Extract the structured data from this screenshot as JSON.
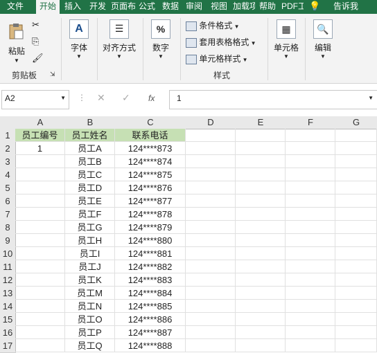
{
  "tabs": [
    "文件",
    "开始",
    "插入",
    "开发",
    "页面布",
    "公式",
    "数据",
    "审阅",
    "视图",
    "加载项",
    "帮助",
    "PDF工",
    "告诉我"
  ],
  "active_tab": "开始",
  "ribbon": {
    "paste": "粘贴",
    "clipboard_label": "剪贴板",
    "font": "字体",
    "align": "对齐方式",
    "number": "数字",
    "cond_format": "条件格式",
    "table_format": "套用表格格式",
    "cell_style": "单元格样式",
    "styles_label": "样式",
    "cells": "单元格",
    "edit": "编辑"
  },
  "formula_bar": {
    "name_box": "A2",
    "fx": "fx",
    "value": "1"
  },
  "columns": [
    "A",
    "B",
    "C",
    "D",
    "E",
    "F",
    "G"
  ],
  "header_row": [
    "员工编号",
    "员工姓名",
    "联系电话"
  ],
  "rows": [
    [
      "1",
      "员工A",
      "124****873"
    ],
    [
      "",
      "员工B",
      "124****874"
    ],
    [
      "",
      "员工C",
      "124****875"
    ],
    [
      "",
      "员工D",
      "124****876"
    ],
    [
      "",
      "员工E",
      "124****877"
    ],
    [
      "",
      "员工F",
      "124****878"
    ],
    [
      "",
      "员工G",
      "124****879"
    ],
    [
      "",
      "员工H",
      "124****880"
    ],
    [
      "",
      "员工I",
      "124****881"
    ],
    [
      "",
      "员工J",
      "124****882"
    ],
    [
      "",
      "员工K",
      "124****883"
    ],
    [
      "",
      "员工M",
      "124****884"
    ],
    [
      "",
      "员工N",
      "124****885"
    ],
    [
      "",
      "员工O",
      "124****886"
    ],
    [
      "",
      "员工P",
      "124****887"
    ],
    [
      "",
      "员工Q",
      "124****888"
    ]
  ],
  "colors": {
    "ribbon_green": "#217346",
    "header_fill": "#c6e0b4"
  }
}
